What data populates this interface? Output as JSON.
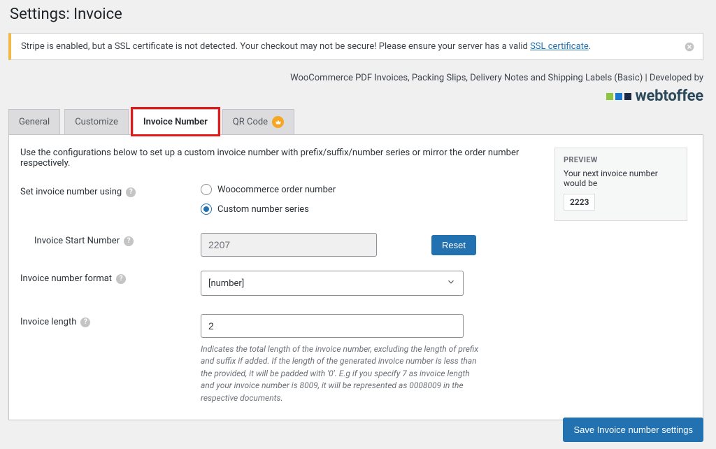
{
  "page_title": "Settings: Invoice",
  "alert": {
    "text_prefix": "Stripe is enabled, but a SSL certificate is not detected. Your checkout may not be secure! Please ensure your server has a valid ",
    "link_text": "SSL certificate",
    "text_suffix": "."
  },
  "developed_by": "WooCommerce PDF Invoices, Packing Slips, Delivery Notes and Shipping Labels (Basic) | Developed by",
  "brand_name": "webtoffee",
  "tabs": {
    "general": "General",
    "customize": "Customize",
    "invoice_number": "Invoice Number",
    "qr_code": "QR Code"
  },
  "intro": "Use the configurations below to set up a custom invoice number with prefix/suffix/number series or mirror the order number respectively.",
  "labels": {
    "set_using": "Set invoice number using",
    "start_number": "Invoice Start Number",
    "number_format": "Invoice number format",
    "invoice_length": "Invoice length"
  },
  "radio": {
    "woo": "Woocommerce order number",
    "custom": "Custom number series"
  },
  "values": {
    "start_number": "2207",
    "format_selected": "[number]",
    "invoice_length": "2"
  },
  "buttons": {
    "reset": "Reset",
    "save": "Save Invoice number settings"
  },
  "helper": "Indicates the total length of the invoice number, excluding the length of prefix and suffix if added. If the length of the generated invoice number is less than the provided, it will be padded with '0'. E.g if you specify 7 as invoice length and your invoice number is 8009, it will be represented as 0008009 in the respective documents.",
  "preview": {
    "title": "PREVIEW",
    "desc": "Your next invoice number would be",
    "value": "2223"
  }
}
